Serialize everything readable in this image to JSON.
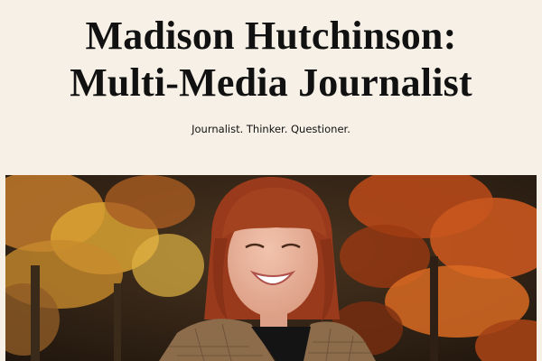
{
  "header": {
    "title_line1": "Madison Hutchinson:",
    "title_line2": "Multi-Media Journalist",
    "tagline": "Journalist. Thinker. Questioner."
  },
  "hero": {
    "description": "photo",
    "colors": {
      "background": "#f6f0e7",
      "foliage_orange": "#c8561e",
      "foliage_gold": "#d9a233",
      "hair": "#9a3a1c",
      "skin": "#e9b49d"
    }
  }
}
